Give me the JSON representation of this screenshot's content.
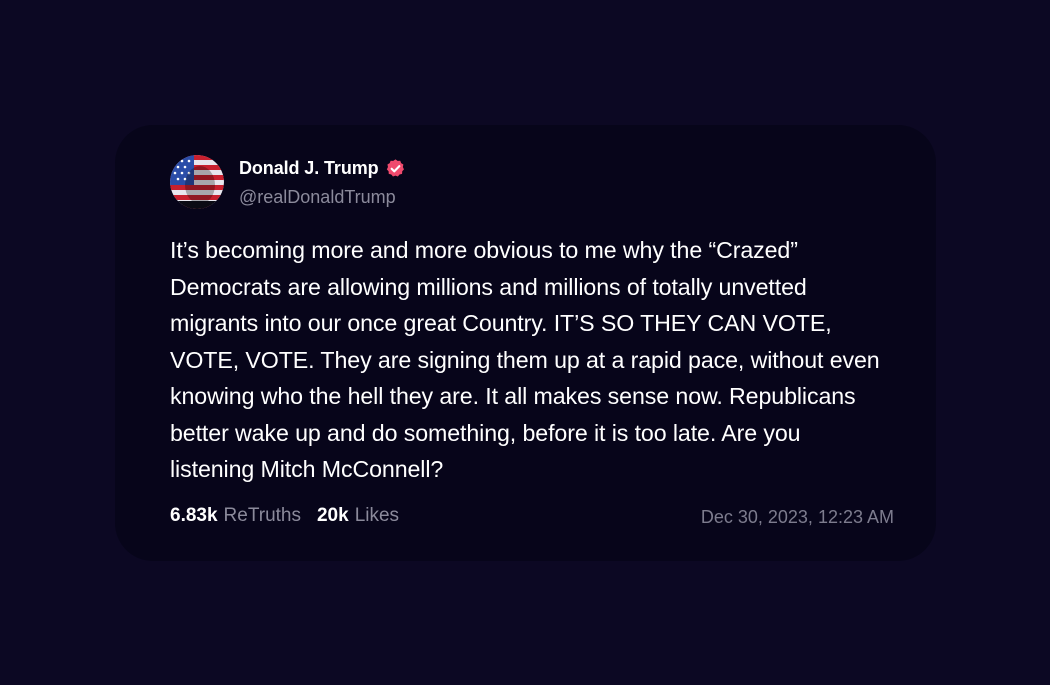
{
  "post": {
    "author_name": "Donald J. Trump",
    "author_handle": "@realDonaldTrump",
    "verified_icon": "verified-badge-icon",
    "avatar_icon": "avatar-flag-face",
    "text": "It’s becoming more and more obvious to me why the “Crazed” Democrats are allowing millions and millions of totally unvetted migrants into our once great Country. IT’S SO THEY CAN VOTE, VOTE, VOTE. They are signing them up at a rapid pace, without even knowing who the hell they are. It all makes sense now. Republicans better wake up and do something, before it is too late. Are you listening Mitch McConnell?",
    "retruths_count": "6.83k",
    "retruths_label": "ReTruths",
    "likes_count": "20k",
    "likes_label": "Likes",
    "timestamp": "Dec 30, 2023, 12:23 AM"
  },
  "colors": {
    "page_background": "#0c0823",
    "card_background": "#07051a",
    "verified_badge": "#ef4a6d",
    "muted_text": "#8b8a9b"
  }
}
